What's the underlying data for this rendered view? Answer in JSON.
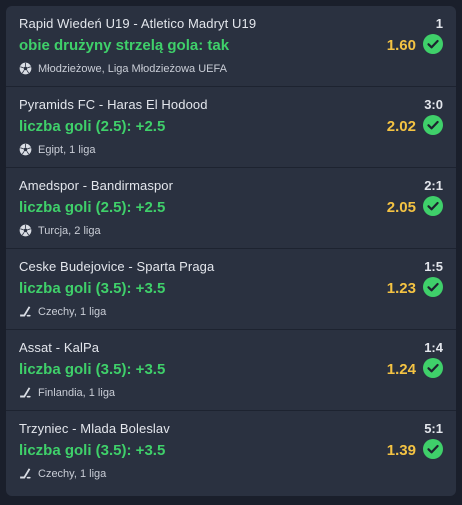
{
  "bets": [
    {
      "match": "Rapid Wiedeń U19 - Atletico Madryt U19",
      "score": "1",
      "pick": "obie drużyny strzelą gola: tak",
      "odds": "1.60",
      "league": "Młodzieżowe, Liga Młodzieżowa UEFA",
      "sport_icon": "football-icon"
    },
    {
      "match": "Pyramids FC - Haras El Hodood",
      "score": "3:0",
      "pick": "liczba goli (2.5): +2.5",
      "odds": "2.02",
      "league": "Egipt, 1 liga",
      "sport_icon": "football-icon"
    },
    {
      "match": "Amedspor - Bandirmaspor",
      "score": "2:1",
      "pick": "liczba goli (2.5): +2.5",
      "odds": "2.05",
      "league": "Turcja, 2 liga",
      "sport_icon": "football-icon"
    },
    {
      "match": "Ceske Budejovice - Sparta Praga",
      "score": "1:5",
      "pick": "liczba goli (3.5): +3.5",
      "odds": "1.23",
      "league": "Czechy, 1 liga",
      "sport_icon": "hockey-icon"
    },
    {
      "match": "Assat - KalPa",
      "score": "1:4",
      "pick": "liczba goli (3.5): +3.5",
      "odds": "1.24",
      "league": "Finlandia, 1 liga",
      "sport_icon": "hockey-icon"
    },
    {
      "match": "Trzyniec - Mlada Boleslav",
      "score": "5:1",
      "pick": "liczba goli (3.5): +3.5",
      "odds": "1.39",
      "league": "Czechy, 1 liga",
      "sport_icon": "hockey-icon"
    }
  ],
  "colors": {
    "pick": "#3fd06a",
    "odds": "#f4c343",
    "check": "#3fd06a",
    "card": "#2a3140",
    "background": "#1a1f2b"
  },
  "status_icon": "check-circle-icon"
}
